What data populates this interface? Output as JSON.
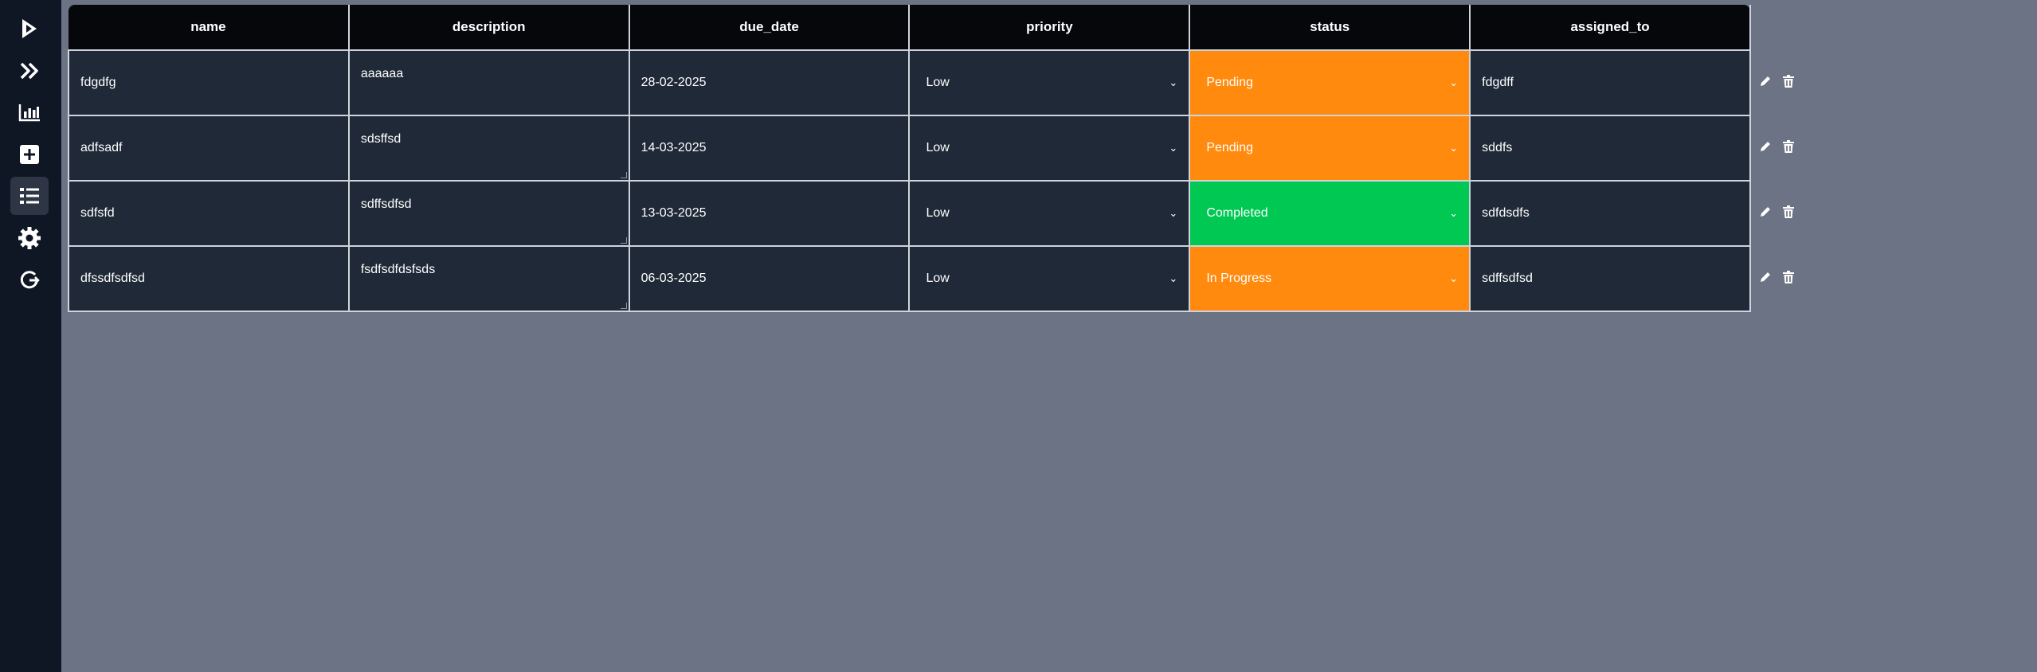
{
  "sidebar": {
    "items": [
      {
        "name": "logo-icon"
      },
      {
        "name": "expand-icon"
      },
      {
        "name": "chart-icon"
      },
      {
        "name": "add-icon"
      },
      {
        "name": "list-icon",
        "active": true
      },
      {
        "name": "settings-icon"
      },
      {
        "name": "logout-icon"
      }
    ]
  },
  "table": {
    "columns": [
      "name",
      "description",
      "due_date",
      "priority",
      "status",
      "assigned_to"
    ],
    "rows": [
      {
        "name": "fdgdfg",
        "description": "aaaaaa",
        "due_date": "28-02-2025",
        "priority": "Low",
        "status": "Pending",
        "assigned_to": "fdgdff"
      },
      {
        "name": "adfsadf",
        "description": "sdsffsd",
        "due_date": "14-03-2025",
        "priority": "Low",
        "status": "Pending",
        "assigned_to": "sddfs"
      },
      {
        "name": "sdfsfd",
        "description": "sdffsdfsd",
        "due_date": "13-03-2025",
        "priority": "Low",
        "status": "Completed",
        "assigned_to": "sdfdsdfs"
      },
      {
        "name": "dfssdfsdfsd",
        "description": "fsdfsdfdsfsds",
        "due_date": "06-03-2025",
        "priority": "Low",
        "status": "In Progress",
        "assigned_to": "sdffsdfsd"
      }
    ]
  },
  "colors": {
    "pending": "#ff8a0d",
    "completed": "#00c853",
    "in_progress": "#ff8a0d",
    "row_bg": "#1f2937",
    "header_bg": "#05070b",
    "page_bg": "#6b7385",
    "sidebar_bg": "#0f1624"
  }
}
